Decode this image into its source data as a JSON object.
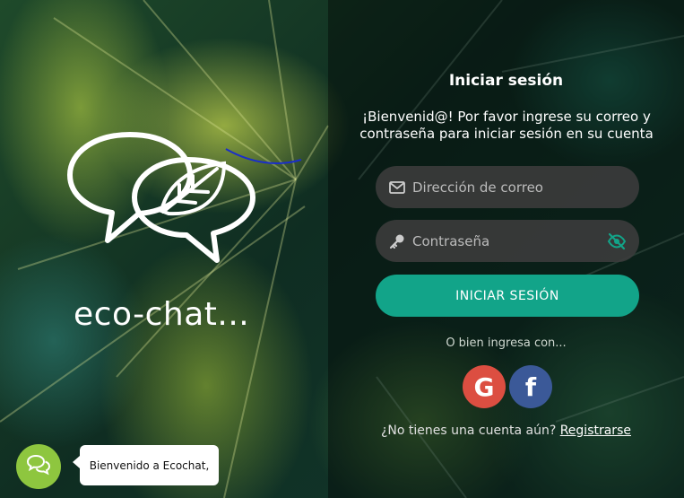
{
  "brand": {
    "name": "eco-chat..."
  },
  "login": {
    "title": "Iniciar sesión",
    "welcome": "¡Bienvenid@! Por favor ingrese su correo y contraseña para iniciar sesión en su cuenta",
    "email_placeholder": "Dirección de correo",
    "password_placeholder": "Contraseña",
    "submit_label": "INICIAR SESIÓN",
    "alt_text": "O bien ingresa con...",
    "google_label": "G",
    "facebook_label": "f",
    "signup_prompt": "¿No tienes una cuenta aún?",
    "signup_link": "Registrarse"
  },
  "chat_widget": {
    "message": "Bienvenido a Ecochat,"
  },
  "colors": {
    "primary": "#12a489",
    "google": "#dc4e41",
    "facebook": "#3b5998",
    "chat": "#8ec63f"
  },
  "icons": {
    "email": "envelope-icon",
    "password": "key-icon",
    "toggle_password": "eye-slash-icon",
    "chat": "chat-bubbles-icon"
  }
}
